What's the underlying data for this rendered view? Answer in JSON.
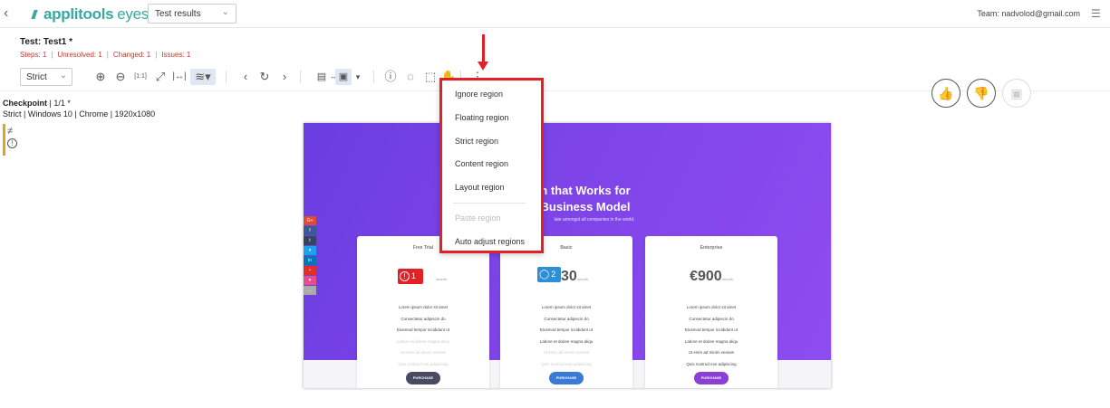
{
  "topbar": {
    "logo_bold": "applitools",
    "logo_light": "eyes",
    "view_select": "Test results",
    "team": "Team: nadvolod@gmail.com"
  },
  "test": {
    "title": "Test: Test1 *",
    "stats": [
      "Steps: 1",
      "Unresolved: 1",
      "Changed: 1",
      "Issues: 1"
    ]
  },
  "toolbar": {
    "match_level": "Strict",
    "icons": [
      "zoom-in-icon",
      "zoom-out-icon",
      "zoom-100-icon",
      "fit-icon",
      "fit-width-icon",
      "layers-icon",
      "prev-icon",
      "refresh-icon",
      "next-icon",
      "compare-view-icon",
      "issue-icon",
      "comment-icon",
      "region-icon",
      "hand-icon",
      "more-icon"
    ]
  },
  "checkpoint": {
    "label": "Checkpoint",
    "counter": "1/1",
    "star": "*",
    "environment": "Strict | Windows 10 | Chrome | 1920x1080"
  },
  "side": {
    "diff_symbol": "≠",
    "issue_symbol": "!"
  },
  "screenshot": {
    "hero_title_line1": "n that Works for",
    "hero_title_line2": "Business Model",
    "hero_subtitle": "late amongst all companies in the world.",
    "social": [
      "G+",
      "f",
      "t",
      "",
      "in",
      "",
      "",
      "..."
    ],
    "cards": [
      {
        "title": "Free Trial",
        "price": "",
        "per": "/month",
        "features": [
          "Lorem ipsum dolor sit amet",
          "Consectetur adipiscin do",
          "Eiusmod tempor incididunt ut",
          "Labore et dolore magna aliqu",
          "Ut enim ad minim veniam",
          "Quis nostrud exe adipiscing"
        ],
        "button": "PURCHASE"
      },
      {
        "title": "Basic",
        "price": "30",
        "per": "/month",
        "features": [
          "Lorem ipsum dolor sit amet",
          "Consectetur adipiscin do",
          "Eiusmod tempor incididunt ut",
          "Labore et dolore magna aliqu",
          "Ut enim ad minim veniam",
          "Quis nostrud exe adipiscing"
        ],
        "button": "PURCHASE"
      },
      {
        "title": "Enterprise",
        "price": "€900",
        "per": "/month",
        "features": [
          "Lorem ipsum dolor sit amet",
          "Consectetur adipiscin do",
          "Eiusmod tempor incididunt ut",
          "Labore et dolore magna aliqu",
          "Ut enim ad minim veniam",
          "Quis nostrud exe adipiscing"
        ],
        "button": "PURCHASE"
      }
    ],
    "issue_badge_count": "1",
    "comment_badge_count": "2"
  },
  "region_menu": {
    "items": [
      "Ignore region",
      "Floating region",
      "Strict region",
      "Content region",
      "Layout region"
    ],
    "disabled_item": "Paste region",
    "last_item": "Auto adjust regions"
  },
  "colors": {
    "accent": "#3aa7a1",
    "highlight": "#e32028",
    "stats": "#c0392b",
    "purple": "#7e44e8"
  }
}
